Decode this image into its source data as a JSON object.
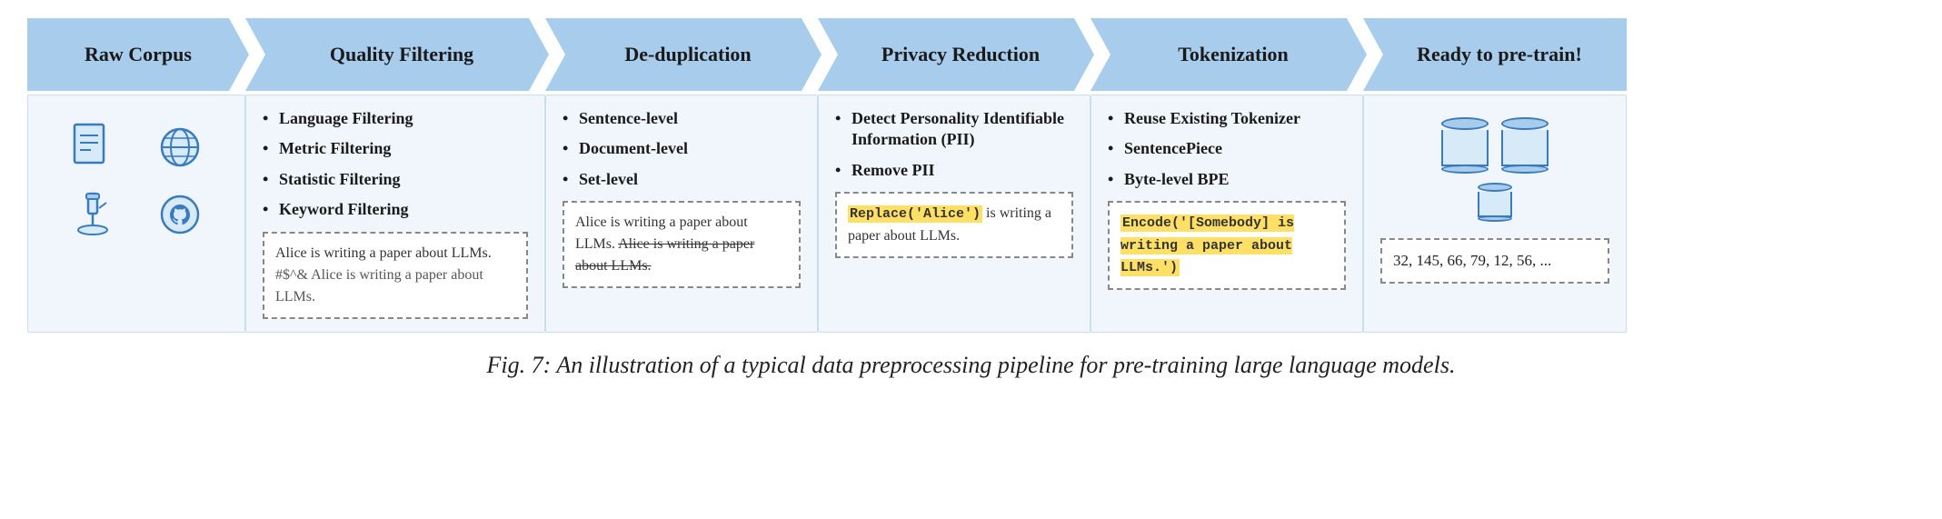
{
  "pipeline": {
    "steps": [
      {
        "id": "raw",
        "header": "Raw Corpus",
        "type": "raw"
      },
      {
        "id": "quality",
        "header": "Quality Filtering",
        "type": "list",
        "items": [
          "Language Filtering",
          "Metric Filtering",
          "Statistic Filtering",
          "Keyword Filtering"
        ],
        "example": {
          "text_parts": [
            {
              "text": "Alice is writing a paper about LLMs. ",
              "type": "normal"
            },
            {
              "text": "#$^& Alice is writing a paper about LLMs.",
              "type": "noise"
            }
          ]
        }
      },
      {
        "id": "dedup",
        "header": "De-duplication",
        "type": "list",
        "items": [
          "Sentence-level",
          "Document-level",
          "Set-level"
        ],
        "example": {
          "text_parts": [
            {
              "text": "Alice is writing a paper about LLMs. ",
              "type": "normal"
            },
            {
              "text": "Alice is writing a paper about LLMs.",
              "type": "strikethrough"
            }
          ]
        }
      },
      {
        "id": "privacy",
        "header": "Privacy Reduction",
        "type": "list",
        "items": [
          "Detect Personality Identifiable Information (PII)",
          "Remove PII"
        ],
        "example": {
          "text_parts": [
            {
              "text": "Replace('Alice')",
              "type": "code"
            },
            {
              "text": " is writing a paper about LLMs.",
              "type": "normal"
            }
          ]
        }
      },
      {
        "id": "tokenization",
        "header": "Tokenization",
        "type": "list",
        "items": [
          "Reuse Existing Tokenizer",
          "SentencePiece",
          "Byte-level BPE"
        ],
        "example": {
          "text_parts": [
            {
              "text": "Encode('[Somebody] is writing a paper about LLMs.')",
              "type": "code"
            }
          ]
        }
      },
      {
        "id": "ready",
        "header": "Ready to pre-train!",
        "type": "ready",
        "numbers": "32, 145, 66, 79, 12, 56, ..."
      }
    ]
  },
  "caption": "Fig. 7: An illustration of a typical data preprocessing pipeline for pre-training large language models."
}
